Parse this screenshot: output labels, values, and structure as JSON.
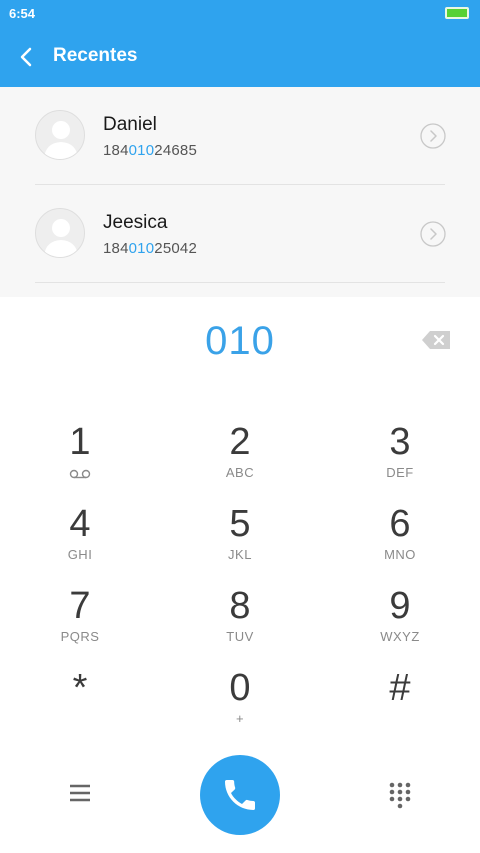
{
  "status_bar": {
    "time": "6:54"
  },
  "header": {
    "title": "Recentes"
  },
  "contacts": [
    {
      "name": "Daniel",
      "number_prefix": "184",
      "number_match": "010",
      "number_suffix": "24685"
    },
    {
      "name": "Jeesica",
      "number_prefix": "184",
      "number_match": "010",
      "number_suffix": "25042"
    }
  ],
  "dialer": {
    "input": "010",
    "keys": [
      {
        "digit": "1",
        "letters": ""
      },
      {
        "digit": "2",
        "letters": "ABC"
      },
      {
        "digit": "3",
        "letters": "DEF"
      },
      {
        "digit": "4",
        "letters": "GHI"
      },
      {
        "digit": "5",
        "letters": "JKL"
      },
      {
        "digit": "6",
        "letters": "MNO"
      },
      {
        "digit": "7",
        "letters": "PQRS"
      },
      {
        "digit": "8",
        "letters": "TUV"
      },
      {
        "digit": "9",
        "letters": "WXYZ"
      },
      {
        "digit": "*",
        "letters": ""
      },
      {
        "digit": "0",
        "letters": "+"
      },
      {
        "digit": "#",
        "letters": ""
      }
    ]
  },
  "colors": {
    "accent": "#2fa3ee",
    "battery": "#57d135"
  },
  "icons": [
    "back-arrow-icon",
    "person-avatar-icon",
    "chevron-right-circle-icon",
    "backspace-icon",
    "voicemail-icon",
    "menu-icon",
    "phone-icon",
    "dialpad-icon"
  ]
}
